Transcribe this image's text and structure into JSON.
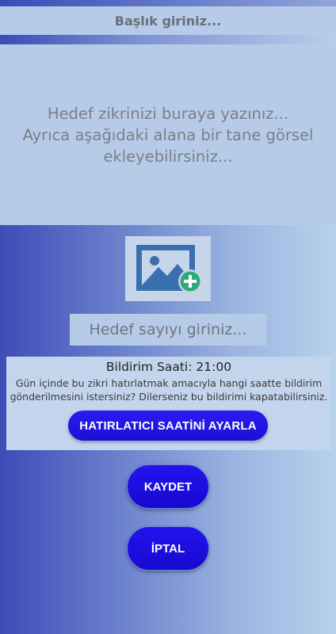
{
  "header": {
    "title_placeholder": "Başlık giriniz..."
  },
  "goal_text": {
    "placeholder_line1": "Hedef zikrinizi buraya yazınız...",
    "placeholder_line2": "Ayrıca aşağıdaki alana bir tane görsel",
    "placeholder_line3": "ekleyebilirsiniz..."
  },
  "image_picker": {
    "icon": "add-image-icon"
  },
  "target_count": {
    "placeholder": "Hedef sayıyı giriniz..."
  },
  "reminder": {
    "time_label": "Bildirim Saati: 21:00",
    "description_line1": "Gün içinde bu zikri hatırlatmak amacıyla hangi saatte bildirim",
    "description_line2": "gönderilmesini istersiniz? Dilerseniz bu bildirimi kapatabilirsiniz.",
    "set_button_label": "HATIRLATICI SAATİNİ AYARLA"
  },
  "actions": {
    "save_label": "KAYDET",
    "cancel_label": "İPTAL"
  },
  "colors": {
    "button_blue": "#1f12e6",
    "field_bg": "#b6cbe8",
    "image_blue": "#3a6fae",
    "plus_green": "#2eaa7a"
  }
}
